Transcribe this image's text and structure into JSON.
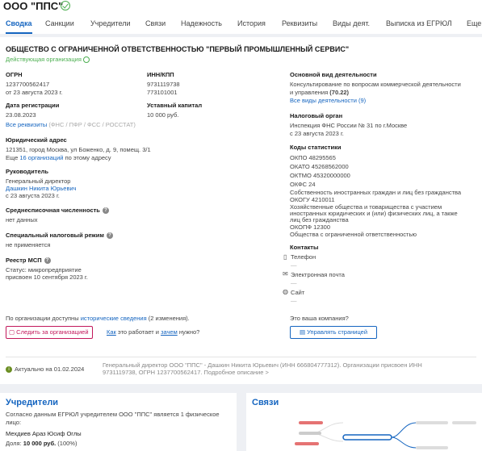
{
  "header": {
    "title": "ООО \"ППС\""
  },
  "tabs": [
    "Сводка",
    "Санкции",
    "Учредители",
    "Связи",
    "Надежность",
    "История",
    "Реквизиты",
    "Виды деят.",
    "Выписка из ЕГРЮЛ",
    "Еще"
  ],
  "main": {
    "full_name": "ОБЩЕСТВО С ОГРАНИЧЕННОЙ ОТВЕТСТВЕННОСТЬЮ \"ПЕРВЫЙ ПРОМЫШЛЕННЫЙ СЕРВИС\"",
    "status": "Действующая организация",
    "ogrn_label": "ОГРН",
    "ogrn": "1237700562417",
    "ogrn_date": "от 23 августа 2023 г.",
    "inn_label": "ИНН/КПП",
    "inn": "9731119738",
    "kpp": "773101001",
    "reg_label": "Дата регистрации",
    "reg_date": "23.08.2023",
    "capital_label": "Уставный капитал",
    "capital": "10 000 руб.",
    "requisites_link": "Все реквизиты",
    "requisites_sources": "(ФНС / ПФР / ФСС / РОССТАТ)",
    "address_label": "Юридический адрес",
    "address": "121351, город Москва, ул Боженко, д. 9, помещ. 3/1",
    "address_more_prefix": "Еще ",
    "address_more_link": "16 организаций",
    "address_more_suffix": " по этому адресу",
    "head_label": "Руководитель",
    "head_position": "Генеральный директор",
    "head_name": "Дашкин Никита Юрьевич",
    "head_since": "с 23 августа 2023 г.",
    "employees_label": "Среднесписочная численность",
    "employees": "нет данных",
    "tax_regime_label": "Специальный налоговый режим",
    "tax_regime": "не применяется",
    "msp_label": "Реестр МСП",
    "msp_status": "Статус: микропредприятие",
    "msp_date": "присвоен 10 сентября 2023 г.",
    "activity_label": "Основной вид деятельности",
    "activity_line1": "Консультирование по вопросам коммерческой деятельности",
    "activity_line2": "и управления",
    "activity_code": "(70.22)",
    "activity_link": "Все виды деятельности (9)",
    "tax_label": "Налоговый орган",
    "tax_line1": "Инспекция ФНС России № 31 по г.Москве",
    "tax_line2": "с 23 августа 2023 г.",
    "stat_label": "Коды статистики",
    "okpo": "ОКПО   48295565",
    "okato": "ОКАТО  45268562000",
    "oktmo": "ОКТМО  45320000000",
    "okfs1": "ОКФС   24",
    "okfs2": "Собственность иностранных граждан и лиц без гражданства",
    "okogu1": "ОКОГУ  4210011",
    "okogu2": "Хозяйственные общества и товарищества с участием",
    "okogu3": "иностранных юридических и (или) физических лиц, а также",
    "okogu4": "лиц без гражданства",
    "okopf1": "ОКОПФ 12300",
    "okopf2": "Общества с ограниченной ответственностью",
    "contacts_label": "Контакты",
    "phone_label": "Телефон",
    "email_label": "Электронная почта",
    "site_label": "Сайт",
    "dash": "—",
    "history_prefix": "По организации доступны ",
    "history_link": "исторические сведения",
    "history_suffix": " (2 изменения).",
    "follow_button": "Следить за организацией",
    "how_link": "Как",
    "how_mid": " это работает и ",
    "why_link": "зачем",
    "how_end": " нужно?",
    "own_company": "Это ваша компания?",
    "manage_button": "Управлять страницей",
    "actual": "Актуально на 01.02.2024",
    "summary1": "Генеральный директор ООО \"ППС\" - Дашкин Никита Юрьевич (ИНН 666804777312). Организации присвоен ИНН",
    "summary2": "9731119738, ОГРН 1237700562417. Подробное описание >"
  },
  "founders": {
    "title": "Учредители",
    "text1": "Согласно данным ЕГРЮЛ учредителем ООО \"ППС\" является 1 физическое",
    "text2": "лицо:",
    "person": "Мехдиев Араз Юсиф Оглы",
    "share_label": "Доля:",
    "share_value": "10 000 руб.",
    "share_pct": "(100%)"
  },
  "links": {
    "title": "Связи"
  },
  "colors": {
    "accent": "#1565c0",
    "active": "#4caf50",
    "follow": "#c2185b"
  }
}
